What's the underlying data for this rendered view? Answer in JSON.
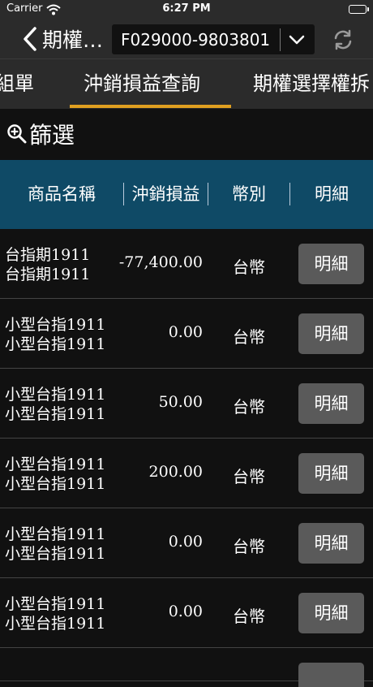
{
  "status_bar": {
    "carrier": "Carrier",
    "time": "6:27 PM",
    "battery_level": 1.0
  },
  "nav": {
    "back_title": "期權…",
    "account": "F029000-9803801"
  },
  "tabs": [
    {
      "label": "組單",
      "active": false
    },
    {
      "label": "沖銷損益查詢",
      "active": true
    },
    {
      "label": "期權選擇權拆",
      "active": false
    }
  ],
  "filter": {
    "label": "篩選"
  },
  "table": {
    "headers": [
      "商品名稱",
      "沖銷損益",
      "幣別",
      "明細"
    ],
    "rows": [
      {
        "product_line1": "台指期1911",
        "product_line2": "台指期1911",
        "pnl": "-77,400.00",
        "currency": "台幣",
        "detail": "明細"
      },
      {
        "product_line1": "小型台指1911",
        "product_line2": "小型台指1911",
        "pnl": "0.00",
        "currency": "台幣",
        "detail": "明細"
      },
      {
        "product_line1": "小型台指1911",
        "product_line2": "小型台指1911",
        "pnl": "50.00",
        "currency": "台幣",
        "detail": "明細"
      },
      {
        "product_line1": "小型台指1911",
        "product_line2": "小型台指1911",
        "pnl": "200.00",
        "currency": "台幣",
        "detail": "明細"
      },
      {
        "product_line1": "小型台指1911",
        "product_line2": "小型台指1911",
        "pnl": "0.00",
        "currency": "台幣",
        "detail": "明細"
      },
      {
        "product_line1": "小型台指1911",
        "product_line2": "小型台指1911",
        "pnl": "0.00",
        "currency": "台幣",
        "detail": "明細"
      }
    ]
  },
  "colors": {
    "accent": "#e0a020",
    "header_bg": "#0f4a66",
    "button_bg": "#5a5a5a",
    "bar_bg": "#2b2b2b"
  },
  "icons": {
    "back": "chevron-left-icon",
    "dropdown": "chevron-down-icon",
    "refresh": "refresh-icon",
    "filter": "zoom-in-icon",
    "wifi": "wifi-icon",
    "battery": "battery-icon"
  }
}
